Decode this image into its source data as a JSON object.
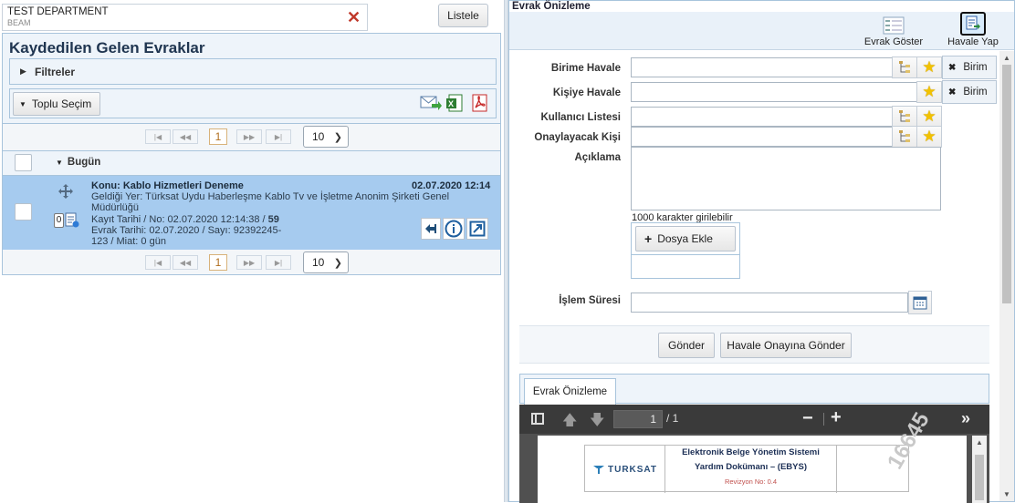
{
  "left": {
    "department": "TEST DEPARTMENT",
    "subunit": "BEAM",
    "list_button": "Listele",
    "title": "Kaydedilen Gelen Evraklar",
    "filters_label": "Filtreler",
    "bulk_select_label": "Toplu Seçim",
    "pager": {
      "page": "1",
      "page_size": "10"
    },
    "group_label": "Bugün",
    "item": {
      "subject": "Konu: Kablo Hizmetleri Deneme",
      "date": "02.07.2020 12:14",
      "from": "Geldiği Yer: Türksat Uydu Haberleşme Kablo Tv ve İşletme Anonim Şirketi Genel Müdürlüğü",
      "record_prefix": "Kayıt Tarihi / No: 02.07.2020 12:14:38 / ",
      "record_no": "59",
      "doc_date": "Evrak Tarihi: 02.07.2020 / Sayı: 92392245-",
      "doc_no_cont": "123 / Miat: 0 gün",
      "attach_count": "0"
    }
  },
  "right": {
    "section_title": "Evrak Önizleme",
    "show_doc_label": "Evrak Göster",
    "forward_label": "Havale Yap",
    "form": {
      "unit_forward": "Birime Havale",
      "person_forward": "Kişiye Havale",
      "user_list": "Kullanıcı Listesi",
      "approver": "Onaylayacak Kişi",
      "description": "Açıklama",
      "char_limit": "1000 karakter girilebilir",
      "add_file": "Dosya Ekle",
      "process_time": "İşlem Süresi",
      "birim_label": "Birim"
    },
    "send_button": "Gönder",
    "send_approval_button": "Havale Onayına Gönder",
    "preview_tab": "Evrak Önizleme",
    "pdf": {
      "page_current": "1",
      "page_total": "/ 1",
      "doc_title_line1": "Elektronik Belge Yönetim Sistemi",
      "doc_title_line2": "Yardım Dokümanı – (EBYS)",
      "revision": "Revizyon No: 0.4",
      "brand": "TURKSAT",
      "watermark": "16645"
    }
  },
  "colors": {
    "accent": "#1f4e79",
    "selected_row": "#a6cbef",
    "panel_bg": "#eef4fa",
    "panel_border": "#a8c4dc",
    "pdf_toolbar": "#3a3a3a",
    "pdf_bg": "#505050"
  }
}
